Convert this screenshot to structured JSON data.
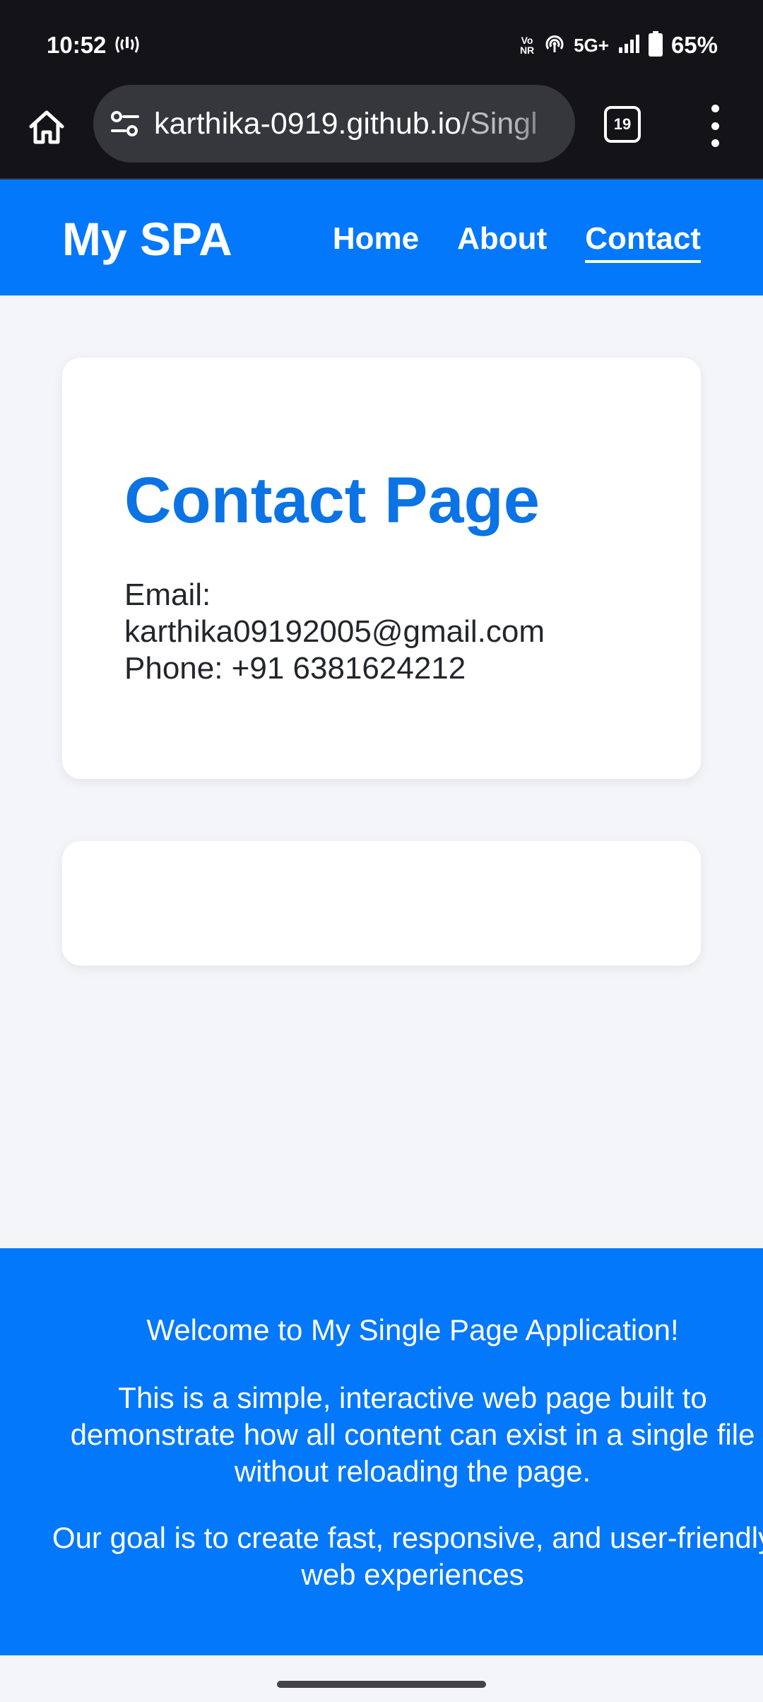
{
  "status_bar": {
    "time": "10:52",
    "network": "5G+",
    "volte_label": "Vo NR",
    "battery": "65%"
  },
  "browser": {
    "url_main": "karthika-0919.github.io",
    "url_path": "/Singl",
    "tab_count": "19"
  },
  "header": {
    "logo": "My SPA",
    "nav": [
      "Home",
      "About",
      "Contact"
    ],
    "active_nav": "Contact"
  },
  "contact": {
    "title": "Contact Page",
    "email_label": "Email:",
    "email": "karthika09192005@gmail.com",
    "phone": "Phone: +91 6381624212"
  },
  "footer": {
    "welcome": "Welcome to My Single Page Application!",
    "paragraph1": [
      "This is a simple, interactive web page built to",
      "demonstrate how all content can exist in a single file",
      "without reloading the page."
    ],
    "paragraph2": [
      "Our goal is to create fast, responsive, and user-friendly",
      "web experiences"
    ]
  },
  "colors": {
    "brand_blue": "#0478fa",
    "title_blue": "#0b73e4",
    "page_bg": "#f3f5f9",
    "chrome_dark": "#141418"
  }
}
